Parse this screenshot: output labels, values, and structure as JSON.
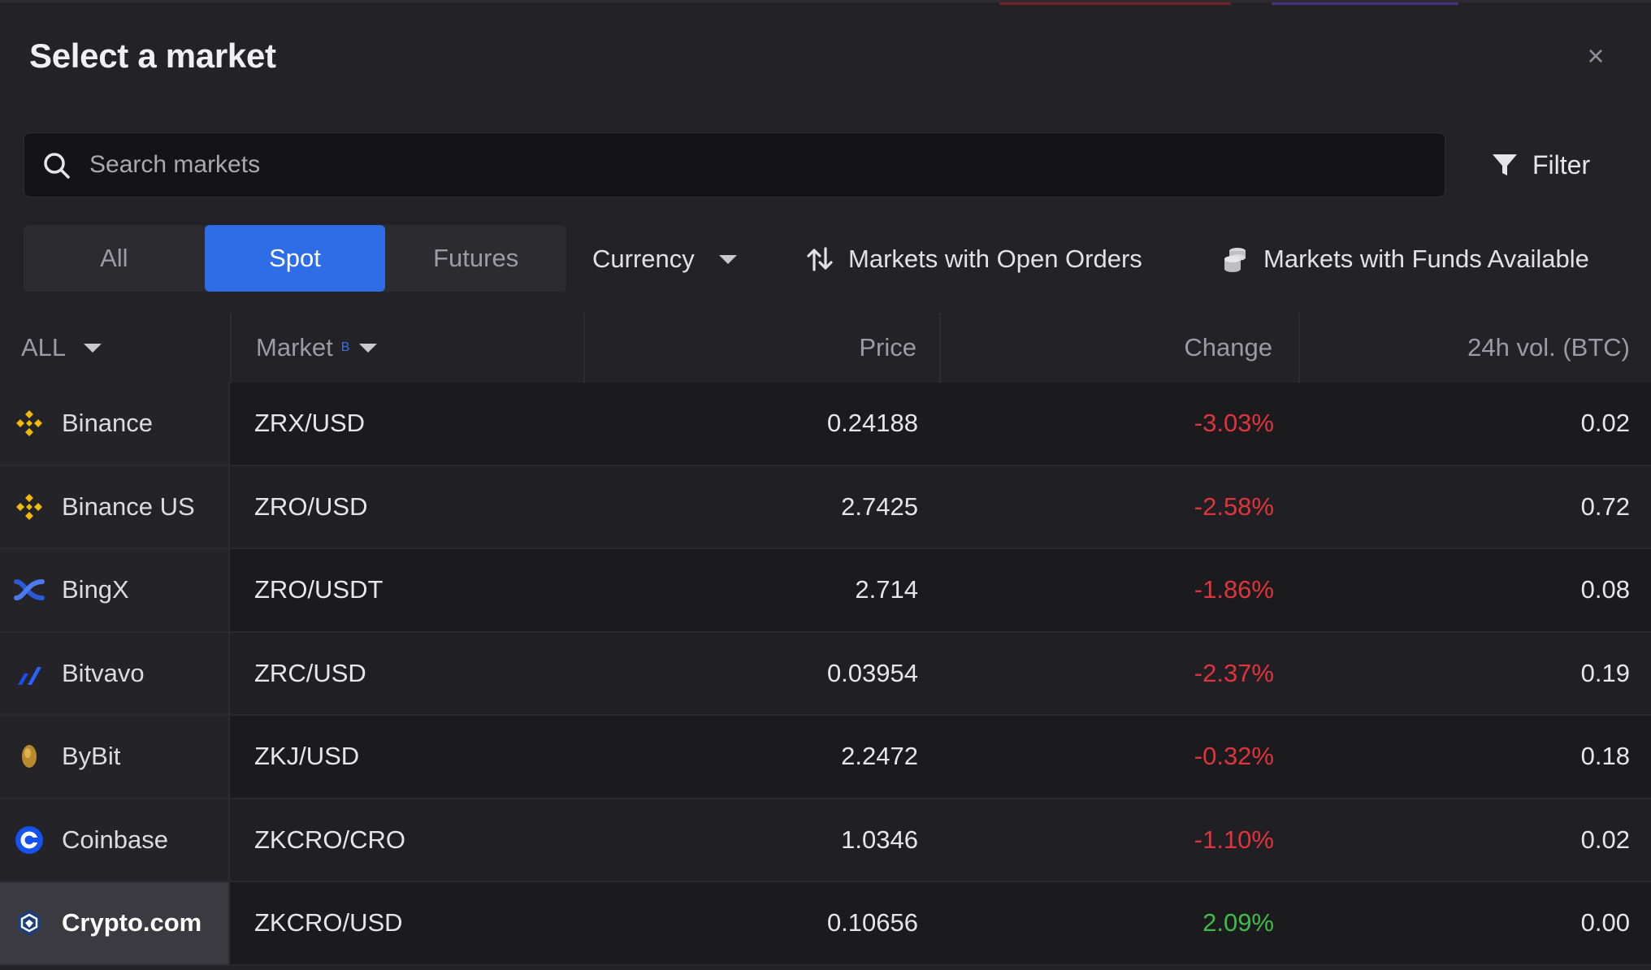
{
  "dialog": {
    "title": "Select a market",
    "close_icon": "×"
  },
  "search": {
    "placeholder": "Search markets",
    "value": ""
  },
  "filter": {
    "label": "Filter"
  },
  "segments": {
    "all": "All",
    "spot": "Spot",
    "futures": "Futures",
    "active": "Spot"
  },
  "toolbar": {
    "currency": "Currency",
    "open_orders": "Markets with Open Orders",
    "funds_available": "Markets with Funds Available"
  },
  "table": {
    "headers": {
      "exchange": "ALL",
      "market": "Market",
      "market_sort_badge": "B",
      "price": "Price",
      "change": "Change",
      "volume": "24h vol. (BTC)"
    },
    "rows": [
      {
        "exchange": "Binance",
        "logo": "binance-icon",
        "market": "ZRX/USD",
        "price": "0.24188",
        "change": "-3.03%",
        "direction": "down",
        "volume": "0.02"
      },
      {
        "exchange": "Binance US",
        "logo": "binance-us-icon",
        "market": "ZRO/USD",
        "price": "2.7425",
        "change": "-2.58%",
        "direction": "down",
        "volume": "0.72"
      },
      {
        "exchange": "BingX",
        "logo": "bingx-icon",
        "market": "ZRO/USDT",
        "price": "2.714",
        "change": "-1.86%",
        "direction": "down",
        "volume": "0.08"
      },
      {
        "exchange": "Bitvavo",
        "logo": "bitvavo-icon",
        "market": "ZRC/USD",
        "price": "0.03954",
        "change": "-2.37%",
        "direction": "down",
        "volume": "0.19"
      },
      {
        "exchange": "ByBit",
        "logo": "bybit-icon",
        "market": "ZKJ/USD",
        "price": "2.2472",
        "change": "-0.32%",
        "direction": "down",
        "volume": "0.18"
      },
      {
        "exchange": "Coinbase",
        "logo": "coinbase-icon",
        "market": "ZKCRO/CRO",
        "price": "1.0346",
        "change": "-1.10%",
        "direction": "down",
        "volume": "0.02"
      },
      {
        "exchange": "Crypto.com",
        "logo": "crypto-com-icon",
        "market": "ZKCRO/USD",
        "price": "0.10656",
        "change": "2.09%",
        "direction": "up",
        "volume": "0.00",
        "selected": true
      }
    ]
  },
  "colors": {
    "accent": "#2f6de6",
    "negative": "#e0343d",
    "positive": "#3fbb4c",
    "binance": "#f0b90b",
    "bingx": "#2a5ada",
    "coinbase": "#1652f0"
  }
}
